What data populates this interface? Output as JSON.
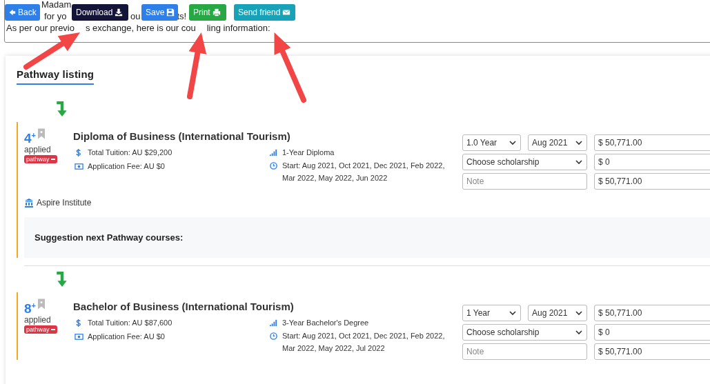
{
  "toolbar": {
    "buttons": [
      {
        "label": "Back",
        "kind": "back"
      },
      {
        "label": "Download",
        "kind": "download"
      },
      {
        "label": "Save",
        "kind": "save"
      },
      {
        "label": "Print",
        "kind": "print"
      },
      {
        "label": "Send friend",
        "kind": "send"
      }
    ]
  },
  "message": {
    "lines": [
      [
        "Madam"
      ],
      [
        "for yo",
        "ou",
        "ts!"
      ],
      [
        "As per our previo",
        "s exchange, here is our cou",
        "ling information:"
      ]
    ]
  },
  "annotations": [
    {
      "kind": "arrow"
    },
    {
      "kind": "arrow"
    },
    {
      "kind": "arrow"
    }
  ],
  "pathway": {
    "title": "Pathway listing",
    "courses": [
      {
        "applied_count": "4$^{+}$",
        "applied_label": "applied",
        "badge": "pathway",
        "title": "Diploma of Business (International Tourism)",
        "tuition": "Total Tuition: AU $29,200",
        "fee": "Application Fee: AU $0",
        "level": "1-Year Diploma",
        "start": "Start: Aug 2021, Oct 2021, Dec 2021, Feb 2022, Mar 2022, May 2022, Jun 2022",
        "duration": "1.0 Year",
        "intake": "Aug 2021",
        "price": "$ 50,771.00",
        "scholarship": "Choose scholarship",
        "discount": "$ 0",
        "note_placeholder": "Note",
        "total": "$ 50,771.00",
        "institution": "Aspire Institute",
        "suggestion": "Suggestion next Pathway courses:"
      },
      {
        "applied_count": "8$^{+}$",
        "applied_label": "applied",
        "badge": "pathway",
        "title": "Bachelor of Business (International Tourism)",
        "tuition": "Total Tuition: AU $87,600",
        "fee": "Application Fee: AU $0",
        "level": "3-Year Bachelor's Degree",
        "start": "Start: Aug 2021, Oct 2021, Dec 2021, Feb 2022, Mar 2022, May 2022, Jul 2022",
        "duration": "1 Year",
        "intake": "Aug 2021",
        "price": "$ 50,771.00",
        "scholarship": "Choose scholarship",
        "discount": "$ 0",
        "note_placeholder": "Note",
        "total": "$ 50,771.00"
      }
    ]
  }
}
